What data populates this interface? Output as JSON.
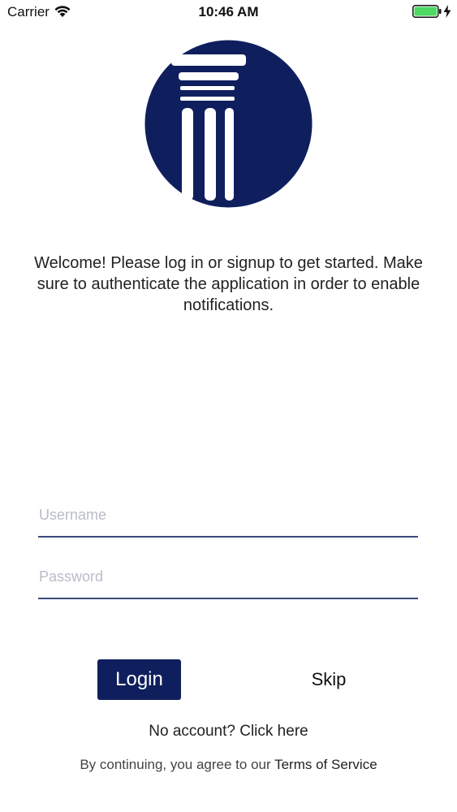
{
  "status_bar": {
    "carrier": "Carrier",
    "time": "10:46 AM",
    "wifi_icon": "wifi-icon",
    "battery_icon": "battery-icon",
    "charging_icon": "charging-bolt-icon"
  },
  "logo": {
    "icon": "pillar-logo-icon",
    "color": "#0f1f5e"
  },
  "welcome_message": "Welcome! Please log in or signup to get started. Make sure to authenticate the application in order to enable notifications.",
  "form": {
    "username": {
      "value": "",
      "placeholder": "Username"
    },
    "password": {
      "value": "",
      "placeholder": "Password"
    }
  },
  "actions": {
    "login_label": "Login",
    "skip_label": "Skip",
    "signup_label": "No account? Click here"
  },
  "terms": {
    "prefix": "By continuing, you agree to our ",
    "link_label": "Terms of Service"
  },
  "colors": {
    "brand": "#0f1f5e",
    "battery": "#4cd964",
    "input_underline": "#3c4a7a"
  }
}
